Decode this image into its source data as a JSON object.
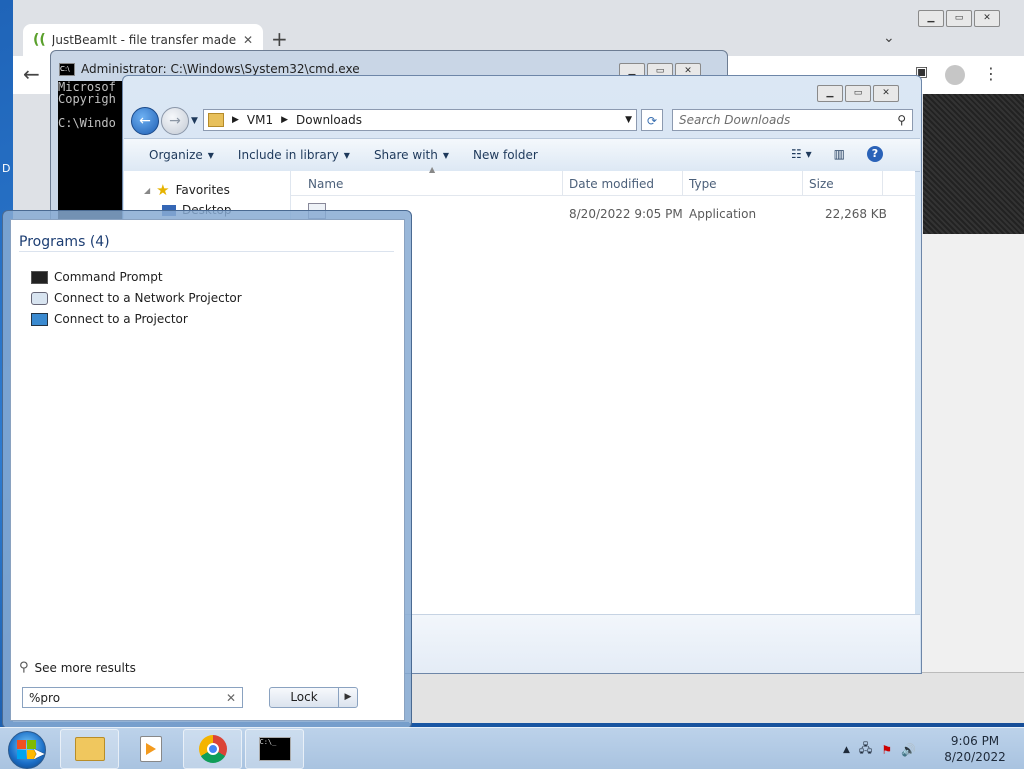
{
  "chrome": {
    "tab_title": "JustBeamIt - file transfer made e",
    "new_tab": "+",
    "tab_close": "✕",
    "back": "←",
    "menu": "⋮",
    "tab_menu": "⌄",
    "side_letter": "D"
  },
  "cmd": {
    "title": "Administrator: C:\\Windows\\System32\\cmd.exe",
    "line1": "Microsof",
    "line2": "Copyrigh",
    "line3": "C:\\Windo"
  },
  "explorer": {
    "path_root": "VM1",
    "path_folder": "Downloads",
    "search_placeholder": "Search Downloads",
    "toolbar": {
      "organize": "Organize",
      "include_in_library": "Include in library",
      "share_with": "Share with",
      "new_folder": "New folder"
    },
    "nav": {
      "favorites": "Favorites",
      "desktop": "Desktop"
    },
    "columns": {
      "name": "Name",
      "date_modified": "Date modified",
      "type": "Type",
      "size": "Size"
    },
    "rows": [
      {
        "name": "",
        "date_modified": "8/20/2022 9:05 PM",
        "type": "Application",
        "size": "22,268 KB"
      }
    ]
  },
  "start_menu": {
    "programs_header": "Programs (4)",
    "programs": [
      {
        "label": "Command Prompt"
      },
      {
        "label": "Connect to a Network Projector"
      },
      {
        "label": "Connect to a Projector"
      }
    ],
    "see_more": "See more results",
    "search_value": "%pro",
    "lock_label": "Lock"
  },
  "taskbar": {
    "time": "9:06 PM",
    "date": "8/20/2022",
    "cmd_glyph": "C:\\_"
  },
  "colors": {
    "desktop": "#2d7bd0",
    "explorer_frame": "#dbe7f4",
    "start_heading": "#1d3e73"
  }
}
